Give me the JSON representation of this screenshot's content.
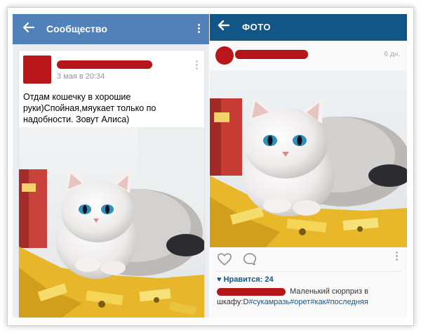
{
  "vk": {
    "header_title": "Сообщество",
    "post": {
      "date": "3 мая в 20:34",
      "text": "Отдам кошечку в хорошие руки)Спойная,мяукает только по надобности. Зовут Алиса)"
    }
  },
  "instagram": {
    "header_title": "ФОТО",
    "time": "6 дн.",
    "likes": "Нравится: 24",
    "caption_text": "Маленький сюрприз в шкафу:D",
    "hashtags": [
      "#сукамразь",
      "#орет",
      "#как",
      "#последняя"
    ]
  },
  "colors": {
    "vk_blue": "#5181b8",
    "ig_blue": "#125688",
    "redaction": "#b3151a"
  },
  "icons": [
    "arrow-left-icon",
    "kebab-menu-icon",
    "heart-icon",
    "comment-icon"
  ]
}
